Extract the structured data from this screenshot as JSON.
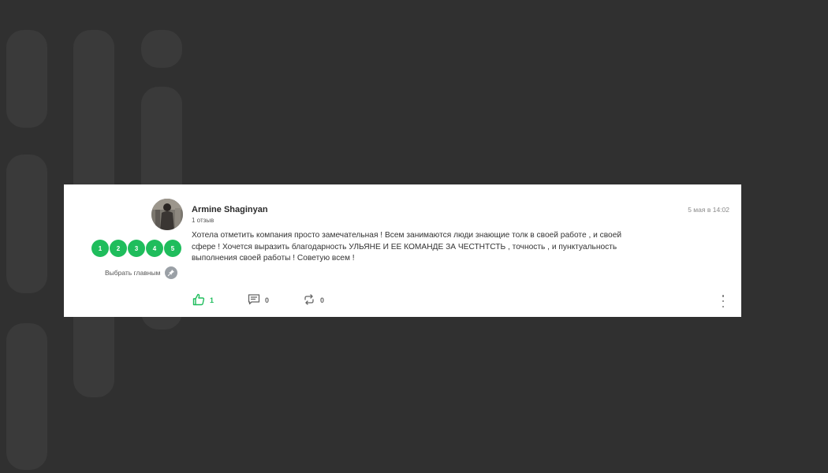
{
  "review": {
    "author": "Armine Shaginyan",
    "review_count": "1 отзыв",
    "date": "5 мая в 14:02",
    "text": "Хотела отметить компания просто замечательная ! Всем занимаются люди знающие толк в своей работе , и своей сфере ! Хочется выразить благодарность УЛЬЯНЕ И ЕЕ КОМАНДЕ ЗА ЧЕСТНТСТЬ , точность , и пунктуальность выполнения своей работы ! Советую всем !",
    "rating_options": [
      "1",
      "2",
      "3",
      "4",
      "5"
    ],
    "make_main_label": "Выбрать главным",
    "likes": "1",
    "comments": "0",
    "reposts": "0"
  },
  "icons": {
    "like": "thumbs-up-icon",
    "comment": "comment-icon",
    "repost": "repost-icon",
    "pin": "pin-icon",
    "more": "more-vertical-icon"
  },
  "colors": {
    "background": "#303030",
    "card": "#ffffff",
    "accent_green": "#1fbd5c"
  }
}
